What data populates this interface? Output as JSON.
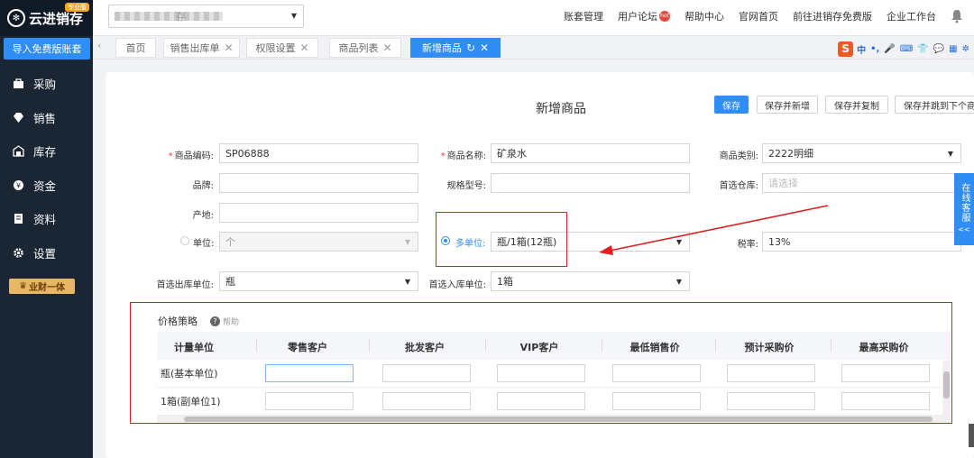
{
  "sidebar": {
    "logo": "云进销存",
    "edition_badge": "专业版",
    "import_button": "导入免费版账套",
    "items": [
      {
        "label": "采购",
        "icon": "bag-icon"
      },
      {
        "label": "销售",
        "icon": "diamond-icon"
      },
      {
        "label": "库存",
        "icon": "warehouse-icon"
      },
      {
        "label": "资金",
        "icon": "coin-icon"
      },
      {
        "label": "资料",
        "icon": "document-icon"
      },
      {
        "label": "设置",
        "icon": "gear-icon"
      }
    ],
    "vip_badge": "业财一体"
  },
  "header": {
    "company_select_partial": "存",
    "links": [
      "账套管理",
      "用户论坛",
      "帮助中心",
      "官网首页",
      "前往进销存免费版",
      "企业工作台"
    ],
    "forum_badge": "hot"
  },
  "tabs": [
    {
      "label": "首页",
      "closable": false
    },
    {
      "label": "销售出库单",
      "closable": true
    },
    {
      "label": "权限设置",
      "closable": true
    },
    {
      "label": "商品列表",
      "closable": true
    },
    {
      "label": "新增商品",
      "closable": true,
      "active": true
    }
  ],
  "ime_toolbar": {
    "logo": "S",
    "items": [
      "中",
      "•,",
      "🎤",
      "⌨",
      "👕",
      "💬",
      "▦",
      "✲"
    ]
  },
  "form": {
    "title": "新增商品",
    "buttons": {
      "save": "保存",
      "save_new": "保存并新增",
      "save_copy": "保存并复制",
      "save_next": "保存并跳到下个商品"
    },
    "code_label": "商品编码:",
    "code_value": "SP06888",
    "name_label": "商品名称:",
    "name_value": "矿泉水",
    "category_label": "商品类别:",
    "category_value": "2222明细",
    "brand_label": "品牌:",
    "brand_value": "",
    "spec_label": "规格型号:",
    "spec_value": "",
    "warehouse_label": "首选仓库:",
    "warehouse_placeholder": "请选择",
    "origin_label": "产地:",
    "origin_value": "",
    "single_unit_label": "单位:",
    "single_unit_value": "个",
    "multi_unit_label": "多单位:",
    "multi_unit_value": "瓶/1箱(12瓶)",
    "tax_label": "税率:",
    "tax_value": "13%",
    "out_unit_label": "首选出库单位:",
    "out_unit_value": "瓶",
    "in_unit_label": "首选入库单位:",
    "in_unit_value": "1箱"
  },
  "price": {
    "title": "价格策略",
    "help": "帮助",
    "columns": [
      "计量单位",
      "零售客户",
      "批发客户",
      "VIP客户",
      "最低销售价",
      "预计采购价",
      "最高采购价"
    ],
    "rows": [
      {
        "unit": "瓶(基本单位)",
        "values": [
          "",
          "",
          "",
          "",
          "",
          ""
        ]
      },
      {
        "unit": "1箱(副单位1)",
        "values": [
          "",
          "",
          "",
          "",
          "",
          ""
        ]
      }
    ]
  },
  "customer_service": {
    "label": "在线客服",
    "arrow": "<<"
  }
}
